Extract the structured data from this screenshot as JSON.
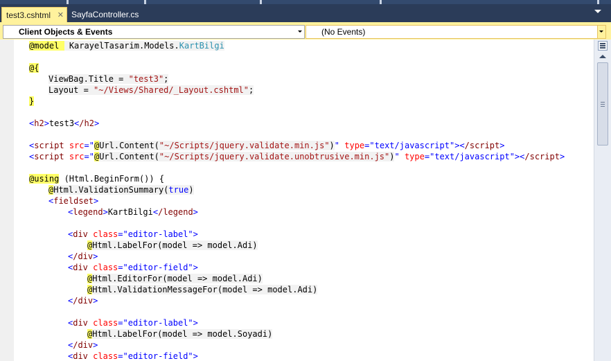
{
  "tabs": [
    {
      "label": "test3.cshtml",
      "active": true
    },
    {
      "label": "SayfaController.cs",
      "active": false
    }
  ],
  "close_glyph": "✕",
  "navbar": {
    "objects": "Client Objects & Events",
    "events": "(No Events)"
  },
  "colors": {
    "chrome": "#2b3c59",
    "active_tab": "#fff29d",
    "razor_highlight": "#ffff66",
    "html_tag": "#800000",
    "html_attr": "#ff0000",
    "string": "#a31515",
    "keyword": "#0000ff",
    "type": "#2b91af"
  },
  "code": {
    "model_kw": "@model",
    "model_ns": " KarayelTasarim.Models.",
    "model_type": "KartBilgi",
    "block_open": "@{",
    "viewbag": "ViewBag.Title = ",
    "viewbag_val": "\"test3\"",
    "semi": ";",
    "layout": "Layout = ",
    "layout_val": "\"~/Views/Shared/_Layout.cshtml\"",
    "block_close": "}",
    "h2_open": "h2",
    "h2_text": "test3",
    "h2_close": "/h2",
    "script": "script",
    "src": "src",
    "eq_q": "=\"",
    "at": "@",
    "url_content": "Url.Content(",
    "script1_path": "\"~/Scripts/jquery.validate.min.js\"",
    "script2_path": "\"~/Scripts/jquery.validate.unobtrusive.min.js\"",
    "close_paren": ")",
    "q": "\"",
    "type_attr": "type",
    "type_val": "\"text/javascript\"",
    "script_close": "/script",
    "using": "@using",
    "using_rest": " (Html.BeginForm()) {",
    "valsum": "Html.ValidationSummary(",
    "true": "true",
    "fieldset": "fieldset",
    "legend": "legend",
    "legend_text": "KartBilgi",
    "legend_close": "/legend",
    "div": "div",
    "class": "class",
    "editor_label": "\"editor-label\"",
    "editor_field": "\"editor-field\"",
    "div_close": "/div",
    "labelfor_adi": "Html.LabelFor(model => model.Adi)",
    "editorfor_adi": "Html.EditorFor(model => model.Adi)",
    "valmsg_adi": "Html.ValidationMessageFor(model => model.Adi)",
    "labelfor_soyadi": "Html.LabelFor(model => model.Soyadi)"
  }
}
